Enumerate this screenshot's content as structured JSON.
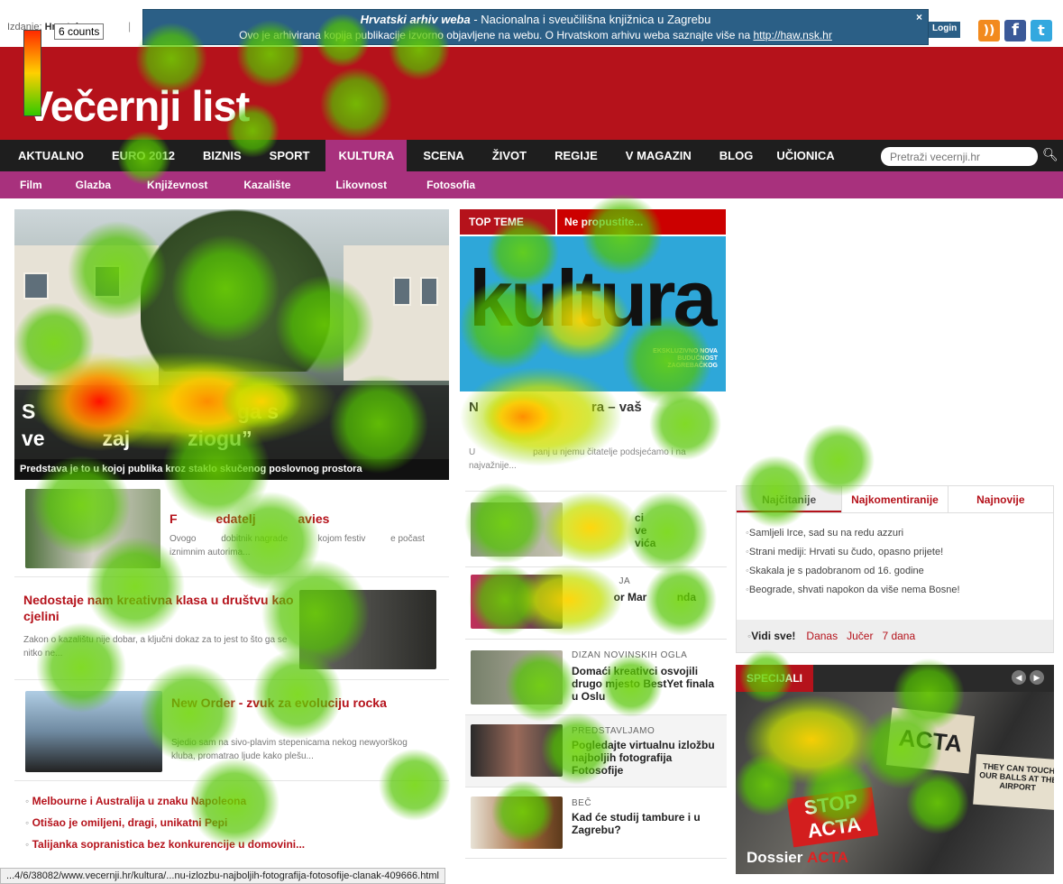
{
  "archive_banner": {
    "title_italic": "Hrvatski arhiv weba",
    "title_rest": " - Nacionalna i sveučilišna knjižnica u Zagrebu",
    "notice": "Ovo je arhivirana kopija publikacije izvorno objavljene na webu. O Hrvatskom arhivu weba saznajte više na ",
    "link": "http://haw.nsk.hr",
    "close": "×"
  },
  "topbar": {
    "edition_label": "Izdanje:",
    "edition_value": "Hrvatska",
    "separator": "|",
    "login": "Login"
  },
  "legend": {
    "label": "6 counts"
  },
  "masthead": {
    "logo": "Večernji list"
  },
  "main_nav": [
    "AKTUALNO",
    "EURO 2012",
    "BIZNIS",
    "SPORT",
    "KULTURA",
    "SCENA",
    "ŽIVOT",
    "REGIJE",
    "V MAGAZIN",
    "BLOG",
    "UČIONICA"
  ],
  "main_nav_active": "KULTURA",
  "search": {
    "placeholder": "Pretraži vecernji.hr"
  },
  "sub_nav": [
    "Film",
    "Glazba",
    "Književnost",
    "Kazalište",
    "Likovnost",
    "Fotosofia"
  ],
  "hero": {
    "title_line1": "S                                   ga s",
    "title_line2": "ve          zaj          ziogu”",
    "caption": "Predstava je to u kojoj publika kroz staklo skučenog poslovnog prostora"
  },
  "left_stories": [
    {
      "title": "F           edatelj            avies",
      "text": "Ovogo          dobitnik nagrade            kojom festiv          e počast iznimnim autorima..."
    },
    {
      "title": "Nedostaje nam kreativna klasa u društvu kao cjelini",
      "text": "Zakon o kazalištu nije dobar, a ključni dokaz za to jest to što ga se nitko ne..."
    },
    {
      "title": "New Order - zvuk za evoluciju rocka",
      "text": "Sjedio sam na sivo-plavim stepenicama nekog newyorškog kluba, promatrao ljude kako plešu..."
    }
  ],
  "left_bullets": [
    "Melbourne i Australija u znaku Napoleona",
    "Otišao je omiljeni, dragi, unikatni Pepi",
    "Talijanka sopranistica bez konkurencije u domovini..."
  ],
  "top_tabs": {
    "tab1": "TOP TEME",
    "tab2": "Ne propustite..."
  },
  "cover": {
    "word": "kultura",
    "small": "EKSKLUZIVNO NOVA BUDUĆNOST ZAGREBAČKOG"
  },
  "featured": {
    "title": "N                              ra – vaš",
    "text": "U                       panj u njemu čitatelje podsjećamo i na najvažnije..."
  },
  "mid_items": [
    {
      "kicker": "",
      "title": "                     ci\n                     ve\n                     vića"
    },
    {
      "kicker": "                JA",
      "title": "              or Mar          nda"
    },
    {
      "kicker": "DIZAN NOVINSKIH OGLA",
      "title": "Domaći kreativci osvojili drugo mjesto BestYet finala u Oslu"
    },
    {
      "kicker": "PREDSTAVLJAMO",
      "title": "Pogledajte virtualnu izložbu najboljih fotografija Fotosofije"
    },
    {
      "kicker": "BEČ",
      "title": "Kad će studij tambure i u Zagrebu?"
    }
  ],
  "right_tabs": [
    "Najčitanije",
    "Najkomentiranije",
    "Najnovije"
  ],
  "most_read": [
    "Samljeli Irce, sad su na redu azzuri",
    "Strani mediji: Hrvati su čudo, opasno prijete!",
    "Skakala je s padobranom od 16. godine",
    "Beograde, shvati napokon da više nema Bosne!"
  ],
  "most_read_footer": {
    "all": "Vidi sve!",
    "filters": [
      "Danas",
      "Jučer",
      "7 dana"
    ]
  },
  "special": {
    "label": "SPECIJALI",
    "sign_stop": "STOP ACTA",
    "sign_acta": "ACTA",
    "sign_bureau": "THEY CAN TOUCH OUR BALLS AT THE AIRPORT",
    "dossier_word": "Dossier",
    "dossier_accent": "ACTA"
  },
  "status_bar": "...4/6/38082/www.vecernji.hr/kultura/...nu-izlozbu-najboljih-fotografija-fotosofije-clanak-409666.html",
  "colors": {
    "brand_red": "#b5121b",
    "nav_dark": "#1e1e1e",
    "culture_magenta": "#a8317d",
    "archive_blue": "#2b5f86"
  }
}
